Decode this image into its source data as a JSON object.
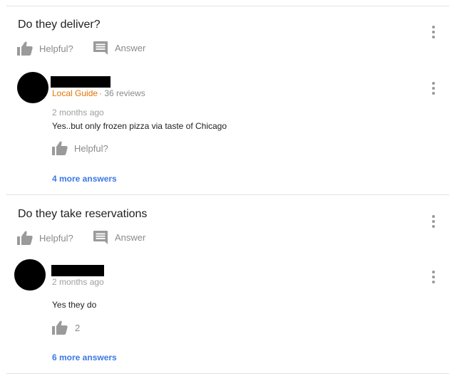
{
  "questions": [
    {
      "title": "Do they deliver?",
      "helpful_label": "Helpful?",
      "answer_label": "Answer",
      "answer": {
        "badge": "Local Guide",
        "reviews": "· 36 reviews",
        "date": "2 months ago",
        "text": "Yes..but only frozen pizza via taste of Chicago",
        "helpful": "Helpful?"
      },
      "more_answers": "4 more answers"
    },
    {
      "title": "Do they take reservations",
      "helpful_label": "Helpful?",
      "answer_label": "Answer",
      "answer": {
        "date": "2 months ago",
        "text": "Yes they do",
        "helpful": "2"
      },
      "more_answers": "6 more answers"
    }
  ],
  "colors": {
    "accent_link": "#3b78e7",
    "local_guide": "#e37400",
    "icon_gray": "#9a9a9a"
  },
  "icons": [
    "thumbs-up-icon",
    "answer-comment-icon",
    "more-vert-icon"
  ]
}
